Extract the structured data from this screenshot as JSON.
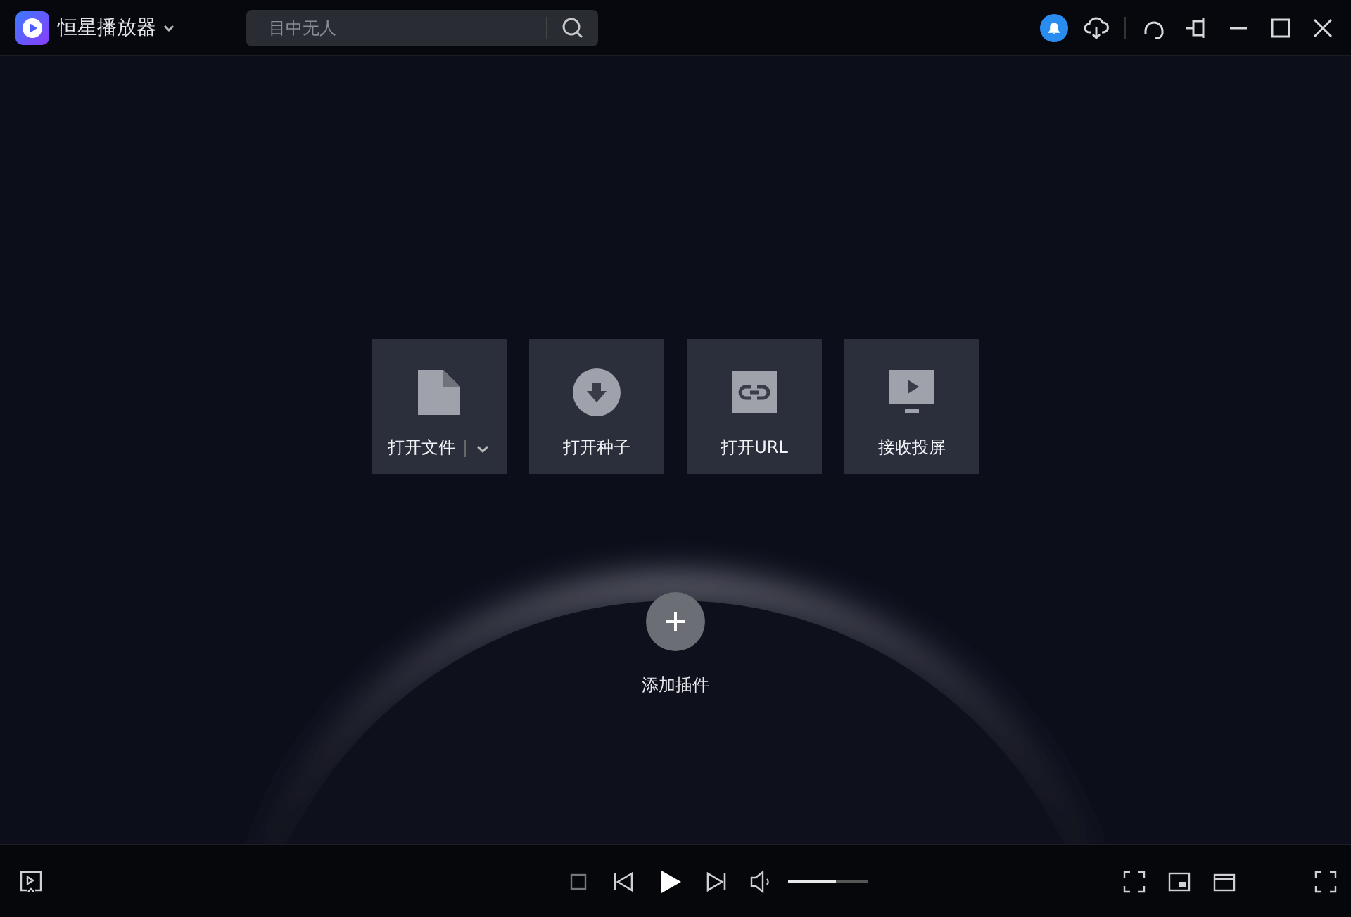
{
  "app": {
    "name": "恒星播放器"
  },
  "search": {
    "placeholder": "目中无人"
  },
  "tiles": [
    {
      "kind": "file",
      "label": "打开文件",
      "has_menu": true
    },
    {
      "kind": "torrent",
      "label": "打开种子",
      "has_menu": false
    },
    {
      "kind": "url",
      "label": "打开URL",
      "has_menu": false
    },
    {
      "kind": "cast",
      "label": "接收投屏",
      "has_menu": false
    }
  ],
  "add_plugin": {
    "label": "添加插件"
  },
  "player": {
    "volume": {
      "level": 0.6
    }
  }
}
